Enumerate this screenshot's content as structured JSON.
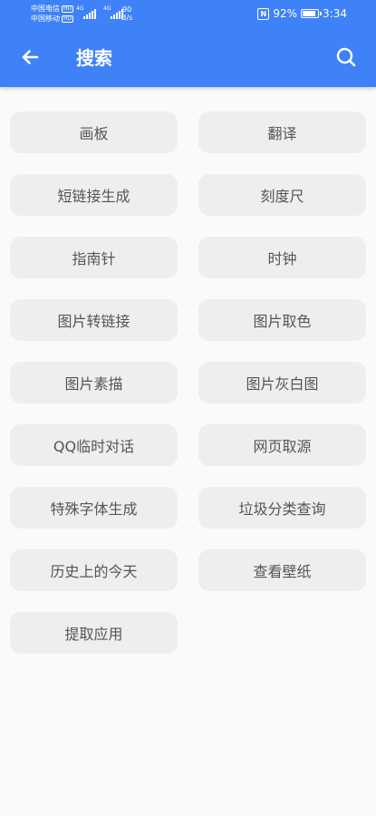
{
  "status_bar": {
    "carrier1": "中国电信",
    "carrier2": "中国移动",
    "hd": "HD",
    "network1": "4G",
    "network2": "4G",
    "speed_value": "90",
    "speed_unit": "B/s",
    "battery_percent": "92%",
    "battery_level": 0.92,
    "time": "3:34"
  },
  "app_bar": {
    "title": "搜索",
    "back_icon": "arrow-left-icon",
    "search_icon": "search-icon"
  },
  "colors": {
    "primary": "#3f82f7",
    "button_bg": "#eeeeee",
    "button_text": "#555555",
    "page_bg": "#fafafa"
  },
  "tools": [
    "画板",
    "翻译",
    "短链接生成",
    "刻度尺",
    "指南针",
    "时钟",
    "图片转链接",
    "图片取色",
    "图片素描",
    "图片灰白图",
    "QQ临时对话",
    "网页取源",
    "特殊字体生成",
    "垃圾分类查询",
    "历史上的今天",
    "查看壁纸",
    "提取应用"
  ]
}
